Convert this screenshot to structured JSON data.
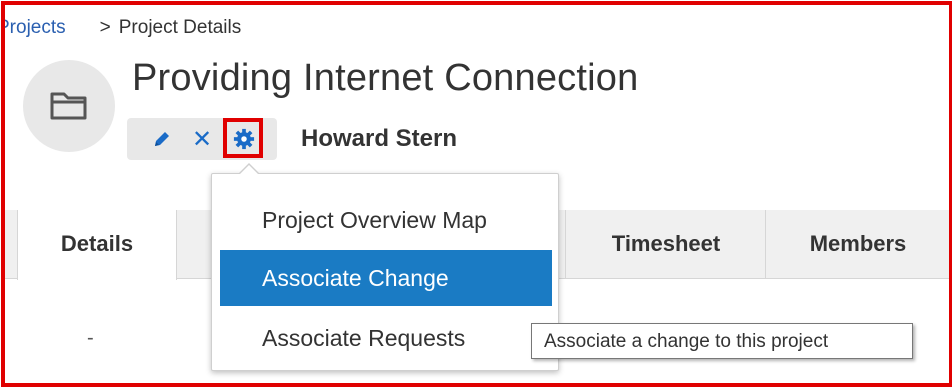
{
  "breadcrumb": {
    "parent": "Projects",
    "separator": ">",
    "current": "Project Details"
  },
  "project": {
    "title": "Providing Internet Connection",
    "owner": "Howard Stern",
    "avatar_icon": "folder-icon"
  },
  "actions": {
    "edit_icon": "pencil-icon",
    "close_icon": "close-icon",
    "close_glyph": "✕",
    "settings_icon": "gear-icon"
  },
  "tabs": [
    {
      "label": "Details"
    },
    {
      "label": "Timesheet"
    },
    {
      "label": "Members"
    }
  ],
  "details_value": "-",
  "menu": {
    "items": [
      {
        "label": "Project Overview Map",
        "selected": false
      },
      {
        "label": "Associate Change",
        "selected": true
      },
      {
        "label": "Associate Requests",
        "selected": false
      }
    ]
  },
  "tooltip": "Associate a change to this project",
  "colors": {
    "highlight_border": "#e00000",
    "menu_selected": "#1a7bc4",
    "icon_blue": "#1a6bc7",
    "link": "#2a5fb0"
  }
}
